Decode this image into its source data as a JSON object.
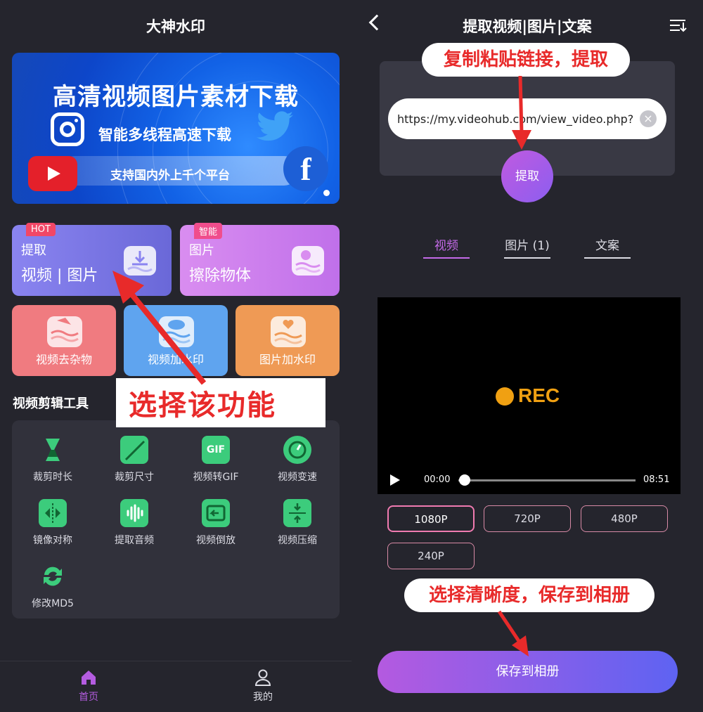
{
  "left": {
    "app_title": "大神水印",
    "banner": {
      "title": "高清视频图片素材下载",
      "subtitle": "智能多线程高速下载",
      "pill": "支持国内外上千个平台"
    },
    "cards": [
      {
        "tag": "HOT",
        "line1": "提取",
        "line2": "视频 | 图片"
      },
      {
        "tag": "智能",
        "line1": "图片",
        "line2": "擦除物体"
      }
    ],
    "small_cards": [
      "视频去杂物",
      "视频加水印",
      "图片加水印"
    ],
    "section_title": "视频剪辑工具",
    "tools": [
      "裁剪时长",
      "裁剪尺寸",
      "视频转GIF",
      "视频变速",
      "镜像对称",
      "提取音频",
      "视频倒放",
      "视频压缩",
      "修改MD5"
    ],
    "gif_glyph": "GIF",
    "annotation": "选择该功能",
    "nav": {
      "home": "首页",
      "mine": "我的"
    }
  },
  "right": {
    "title": "提取视频|图片|文案",
    "bubble_top": "复制粘贴链接，提取",
    "url_value": "https://my.videohub.com/view_video.php?...",
    "extract_label": "提取",
    "tabs": [
      "视频",
      "图片 (1)",
      "文案"
    ],
    "video": {
      "rec_label": "REC",
      "time_current": "00:00",
      "time_total": "08:51",
      "progress": 0.0
    },
    "resolutions": [
      "1080P",
      "720P",
      "480P",
      "240P"
    ],
    "selected_resolution": "1080P",
    "bubble_bottom": "选择清晰度，保存到相册",
    "save_label": "保存到相册"
  },
  "colors": {
    "accent": "#c46ae8",
    "annotation_red": "#e82a2a",
    "tool_green": "#3ccc7c"
  }
}
